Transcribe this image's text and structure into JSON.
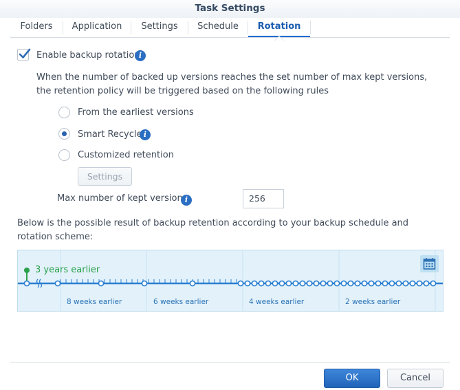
{
  "window": {
    "title": "Task Settings"
  },
  "tabs": [
    {
      "label": "Folders"
    },
    {
      "label": "Application"
    },
    {
      "label": "Settings"
    },
    {
      "label": "Schedule"
    },
    {
      "label": "Rotation",
      "active": true
    }
  ],
  "rotation": {
    "enable_label": "Enable backup rotation",
    "enabled": true,
    "description": "When the number of backed up versions reaches the set number of max kept versions, the retention policy will be triggered based on the following rules",
    "options": [
      {
        "label": "From the earliest versions",
        "selected": false
      },
      {
        "label": "Smart Recycle",
        "selected": true
      },
      {
        "label": "Customized retention",
        "selected": false
      }
    ],
    "settings_button": "Settings",
    "max_label": "Max number of kept versions",
    "max_value": "256",
    "result_description": "Below is the possible result of backup retention according to your backup schedule and rotation scheme:"
  },
  "timeline": {
    "start_label": "3 years earlier",
    "week_labels": [
      "8 weeks earlier",
      "6 weeks earlier",
      "4 weeks earlier",
      "2 weeks earlier"
    ]
  },
  "footer": {
    "ok_label": "OK",
    "cancel_label": "Cancel"
  },
  "colors": {
    "accent": "#2164b9",
    "timeline_bg": "#e2f1fa",
    "timeline_line": "#2b7fd0",
    "start_marker": "#2aa14b"
  },
  "icons": [
    "info-icon",
    "checkmark-icon",
    "calendar-icon"
  ]
}
